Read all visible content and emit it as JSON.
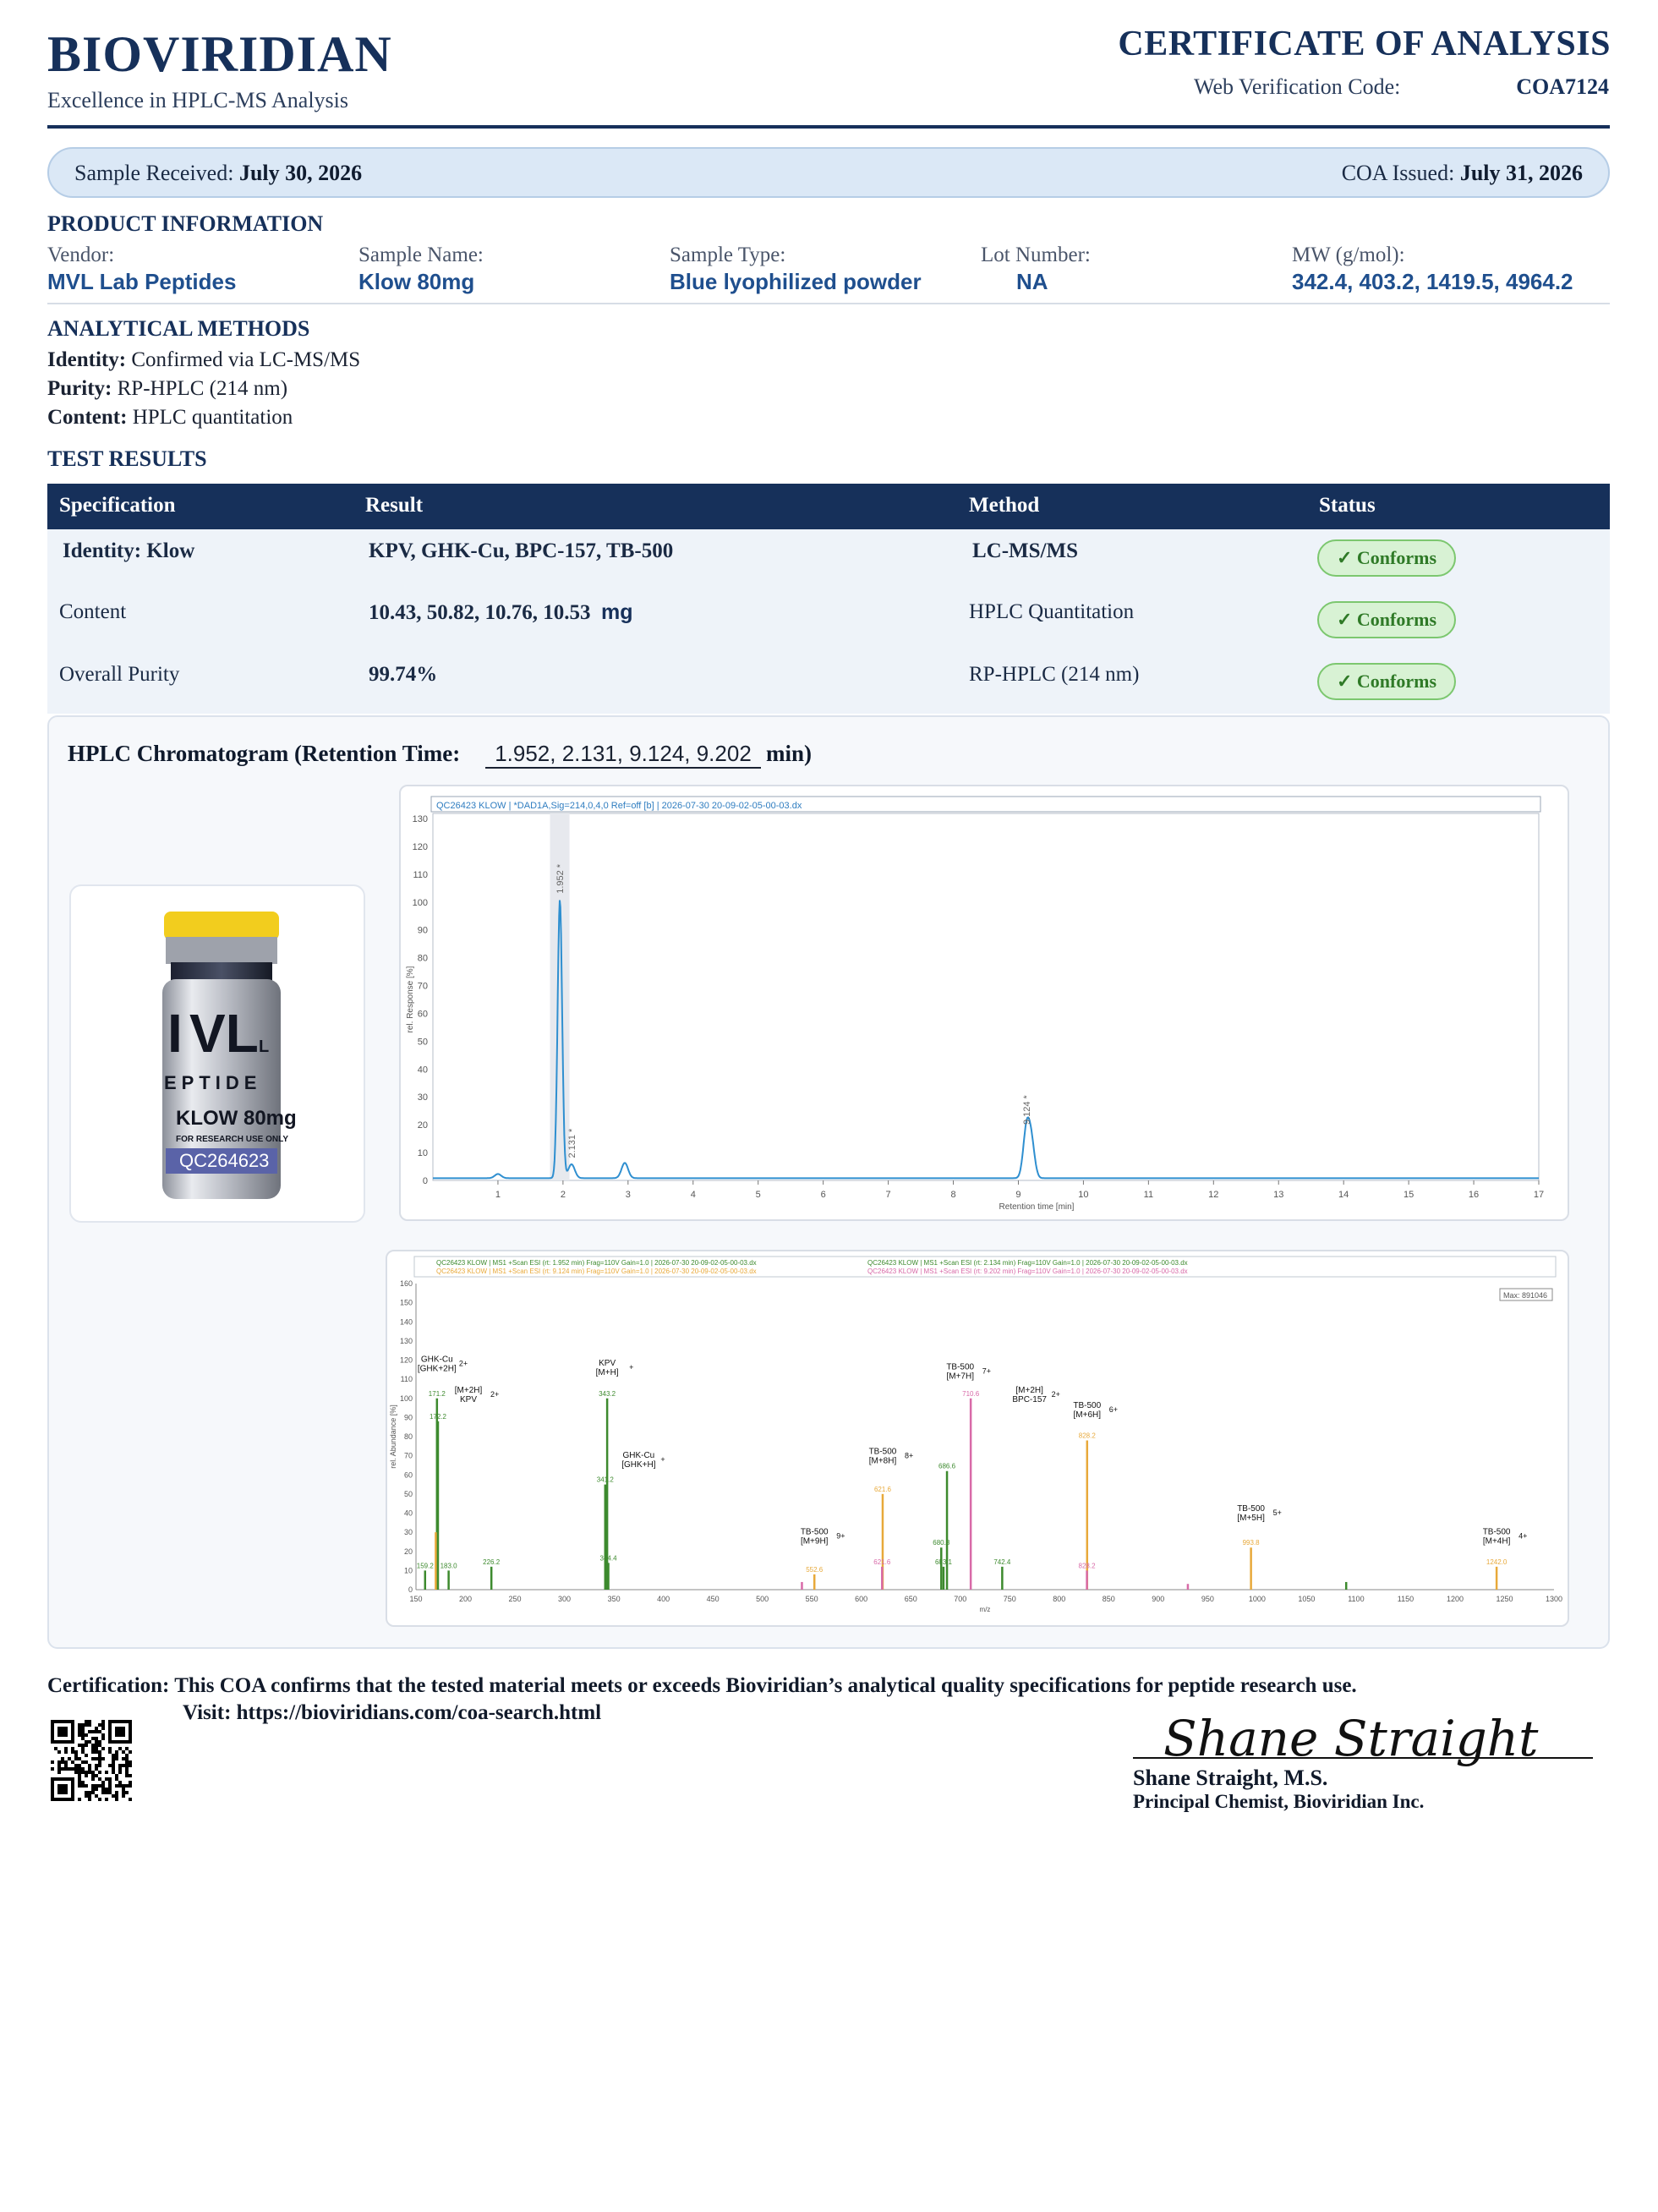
{
  "header": {
    "brand": "BIOVIRIDIAN",
    "tagline": "Excellence in HPLC-MS Analysis",
    "doc_title": "CERTIFICATE OF ANALYSIS",
    "verification_label": "Web Verification Code:",
    "verification_code": "COA7124"
  },
  "dates": {
    "received_label": "Sample Received:",
    "received_value": "July 30, 2026",
    "issued_label": "COA Issued:",
    "issued_value": "July 31, 2026"
  },
  "product_info": {
    "title": "PRODUCT INFORMATION",
    "fields": [
      {
        "label": "Vendor:",
        "value": "MVL Lab Peptides"
      },
      {
        "label": "Sample Name:",
        "value": "Klow 80mg"
      },
      {
        "label": "Sample Type:",
        "value": "Blue lyophilized powder"
      },
      {
        "label": "Lot Number:",
        "value": "NA"
      },
      {
        "label": "MW (g/mol):",
        "value": "342.4, 403.2, 1419.5, 4964.2"
      }
    ]
  },
  "methods": {
    "title": "ANALYTICAL METHODS",
    "items": [
      {
        "label": "Identity:",
        "value": "Confirmed via LC-MS/MS"
      },
      {
        "label": "Purity:",
        "value": "RP-HPLC (214 nm)"
      },
      {
        "label": "Content:",
        "value": "HPLC quantitation"
      }
    ]
  },
  "results": {
    "title": "TEST RESULTS",
    "headers": [
      "Specification",
      "Result",
      "Method",
      "Status"
    ],
    "rows": [
      {
        "spec": "Identity:  Klow",
        "result": "KPV, GHK-Cu, BPC-157, TB-500",
        "method": "LC-MS/MS",
        "status": "✓ Conforms"
      },
      {
        "spec": "Content",
        "result": "10.43, 50.82, 10.76, 10.53",
        "unit": "mg",
        "method": "HPLC Quantitation",
        "status": "✓ Conforms"
      },
      {
        "spec": "Overall Purity",
        "result": "99.74%",
        "method": "RP-HPLC (214 nm)",
        "status": "✓ Conforms"
      }
    ]
  },
  "chromatogram": {
    "title_prefix": "HPLC Chromatogram (Retention Time:",
    "retention_times": "1.952, 2.131, 9.124, 9.202",
    "title_suffix": "min)"
  },
  "vial": {
    "brand_big": "VL",
    "brand_left": "I",
    "brand_right": "L",
    "line2": "EPTIDE",
    "product": "KLOW 80mg",
    "note": "FOR RESEARCH USE ONLY",
    "lot": "QC264623",
    "cap_color": "#f2cd1e",
    "label_band_color": "#5a63a8"
  },
  "chart_data": [
    {
      "type": "line",
      "header": "QC26423 KLOW | *DAD1A,Sig=214,0,4,0 Ref=off [b] | 2026-07-30 20-09-02-05-00-03.dx",
      "xlabel": "Retention time [min]",
      "ylabel": "rel. Response [%]",
      "xlim": [
        0,
        17
      ],
      "ylim": [
        0,
        130
      ],
      "x_ticks": [
        1,
        2,
        3,
        4,
        5,
        6,
        7,
        8,
        9,
        10,
        11,
        12,
        13,
        14,
        15,
        16,
        17
      ],
      "y_ticks": [
        0,
        10,
        20,
        30,
        40,
        50,
        60,
        70,
        80,
        90,
        100,
        110,
        120,
        130
      ],
      "peaks": [
        {
          "x": 1.952,
          "y": 100,
          "label": "1.952 *"
        },
        {
          "x": 2.131,
          "y": 5,
          "label": "2.131 *"
        },
        {
          "x": 9.124,
          "y": 17,
          "label": "9.124 *"
        },
        {
          "x": 9.202,
          "y": 12,
          "label": ""
        }
      ],
      "minor_peaks": [
        {
          "x": 1.0,
          "y": 1.5
        },
        {
          "x": 2.95,
          "y": 5.5
        }
      ],
      "line_color": "#2f8fd0"
    },
    {
      "type": "bar",
      "legend": [
        "QC26423 KLOW | MS1 +Scan ESI (rt: 1.952 min) Frag=110V Gain=1.0 | 2026-07-30 20-09-02-05-00-03.dx",
        "QC26423 KLOW | MS1 +Scan ESI (rt: 2.134 min) Frag=110V Gain=1.0 | 2026-07-30 20-09-02-05-00-03.dx",
        "QC26423 KLOW | MS1 +Scan ESI (rt: 9.124 min) Frag=110V Gain=1.0 | 2026-07-30 20-09-02-05-00-03.dx",
        "QC26423 KLOW | MS1 +Scan ESI (rt: 9.202 min) Frag=110V Gain=1.0 | 2026-07-30 20-09-02-05-00-03.dx"
      ],
      "max_label": "Max: 891046",
      "xlabel": "m/z",
      "ylabel": "rel. Abundance [%]",
      "xlim": [
        150,
        1300
      ],
      "ylim": [
        0,
        160
      ],
      "x_ticks": [
        150,
        200,
        250,
        300,
        350,
        400,
        450,
        500,
        550,
        600,
        650,
        700,
        750,
        800,
        850,
        900,
        950,
        1000,
        1050,
        1100,
        1150,
        1200,
        1250,
        1300
      ],
      "y_ticks": [
        0,
        10,
        20,
        30,
        40,
        50,
        60,
        70,
        80,
        90,
        100,
        110,
        120,
        130,
        140,
        150,
        160
      ],
      "series_colors": [
        "#3d8a2e",
        "#e8a93a",
        "#d86aa8",
        "#8bbf3a"
      ],
      "peaks": [
        {
          "mz": 171.2,
          "y": 100,
          "s": 0,
          "val": "171.2"
        },
        {
          "mz": 172.2,
          "y": 88,
          "s": 0,
          "val": "172.2"
        },
        {
          "mz": 159.2,
          "y": 10,
          "s": 0,
          "val": "159.2"
        },
        {
          "mz": 170.0,
          "y": 30,
          "s": 1,
          "val": ""
        },
        {
          "mz": 183.0,
          "y": 10,
          "s": 0,
          "val": "183.0"
        },
        {
          "mz": 226.2,
          "y": 12,
          "s": 0,
          "val": "226.2"
        },
        {
          "mz": 343.2,
          "y": 100,
          "s": 0,
          "val": "343.2"
        },
        {
          "mz": 341.2,
          "y": 55,
          "s": 0,
          "val": "341.2"
        },
        {
          "mz": 344.4,
          "y": 14,
          "s": 0,
          "val": "344.4"
        },
        {
          "mz": 552.6,
          "y": 8,
          "s": 1,
          "val": "552.6"
        },
        {
          "mz": 621.6,
          "y": 50,
          "s": 1,
          "val": "621.6"
        },
        {
          "mz": 621.0,
          "y": 12,
          "s": 2,
          "val": "621.6"
        },
        {
          "mz": 686.6,
          "y": 62,
          "s": 0,
          "val": "686.6"
        },
        {
          "mz": 680.8,
          "y": 22,
          "s": 0,
          "val": "680.8"
        },
        {
          "mz": 683.1,
          "y": 12,
          "s": 0,
          "val": "683.1"
        },
        {
          "mz": 710.6,
          "y": 100,
          "s": 2,
          "val": "710.6"
        },
        {
          "mz": 742.4,
          "y": 12,
          "s": 0,
          "val": "742.4"
        },
        {
          "mz": 828.2,
          "y": 78,
          "s": 1,
          "val": "828.2"
        },
        {
          "mz": 828.0,
          "y": 10,
          "s": 2,
          "val": "828.2"
        },
        {
          "mz": 993.8,
          "y": 22,
          "s": 1,
          "val": "993.8"
        },
        {
          "mz": 1242.0,
          "y": 12,
          "s": 1,
          "val": "1242.0"
        },
        {
          "mz": 1090.0,
          "y": 4,
          "s": 0,
          "val": ""
        },
        {
          "mz": 540.0,
          "y": 4,
          "s": 2,
          "val": ""
        },
        {
          "mz": 930.0,
          "y": 3,
          "s": 2,
          "val": ""
        }
      ],
      "annotations": [
        {
          "mz": 171.2,
          "y": 108,
          "lines": [
            "GHK-Cu",
            "[GHK+2H]"
          ],
          "charge": "2+"
        },
        {
          "mz": 203.0,
          "y": 92,
          "lines": [
            "[M+2H]",
            "KPV"
          ],
          "charge": "2+"
        },
        {
          "mz": 343.2,
          "y": 106,
          "lines": [
            "KPV",
            "[M+H]"
          ],
          "charge": "+"
        },
        {
          "mz": 375.0,
          "y": 58,
          "lines": [
            "GHK-Cu",
            "[GHK+H]"
          ],
          "charge": "+"
        },
        {
          "mz": 552.6,
          "y": 18,
          "lines": [
            "TB-500",
            "[M+9H]"
          ],
          "charge": "9+"
        },
        {
          "mz": 621.6,
          "y": 60,
          "lines": [
            "TB-500",
            "[M+8H]"
          ],
          "charge": "8+"
        },
        {
          "mz": 700.0,
          "y": 104,
          "lines": [
            "TB-500",
            "[M+7H]"
          ],
          "charge": "7+"
        },
        {
          "mz": 770.0,
          "y": 92,
          "lines": [
            "[M+2H]",
            "BPC-157"
          ],
          "charge": "2+"
        },
        {
          "mz": 828.2,
          "y": 84,
          "lines": [
            "TB-500",
            "[M+6H]"
          ],
          "charge": "6+"
        },
        {
          "mz": 993.8,
          "y": 30,
          "lines": [
            "TB-500",
            "[M+5H]"
          ],
          "charge": "5+"
        },
        {
          "mz": 1242.0,
          "y": 18,
          "lines": [
            "TB-500",
            "[M+4H]"
          ],
          "charge": "4+"
        }
      ]
    }
  ],
  "certification": {
    "label": "Certification:",
    "text": "This COA confirms that the tested material meets or exceeds Bioviridian’s analytical quality specifications for peptide research use.",
    "visit": "Visit: https://bioviridians.com/coa-search.html"
  },
  "signature": {
    "script": "Shane Straight",
    "name": "Shane Straight, M.S.",
    "title": "Principal Chemist, Bioviridian Inc."
  }
}
